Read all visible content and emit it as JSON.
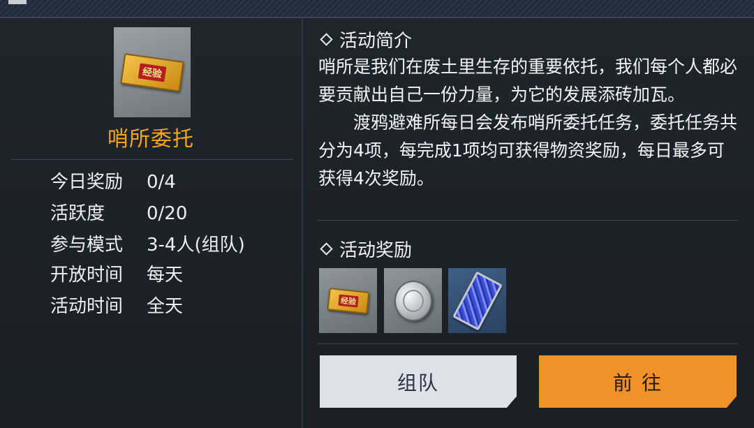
{
  "activity": {
    "icon": "exp-ticket-icon",
    "icon_text": "经验",
    "name": "哨所委托"
  },
  "info": [
    {
      "label": "今日奖励",
      "value": "0/4"
    },
    {
      "label": "活跃度",
      "value": "0/20"
    },
    {
      "label": "参与模式",
      "value": "3-4人(组队)"
    },
    {
      "label": "开放时间",
      "value": "每天"
    },
    {
      "label": "活动时间",
      "value": "全天"
    }
  ],
  "intro": {
    "heading": "活动简介",
    "paragraph1": "哨所是我们在废土里生存的重要依托，我们每个人都必要贡献出自己一份力量，为它的发展添砖加瓦。",
    "paragraph2": "渡鸦避难所每日会发布哨所委托任务，委托任务共分为4项，每完成1项均可获得物资奖励，每日最多可获得4次奖励。"
  },
  "rewards": {
    "heading": "活动奖励",
    "items": [
      {
        "icon": "exp-ticket-icon",
        "text": "经验"
      },
      {
        "icon": "silver-coin-icon"
      },
      {
        "icon": "crystal-module-icon"
      }
    ]
  },
  "buttons": {
    "team_label": "组队",
    "go_label": "前 往"
  },
  "colors": {
    "accent_orange": "#f0912a",
    "title_orange": "#f3a51c",
    "team_button": "#dde2ea"
  }
}
